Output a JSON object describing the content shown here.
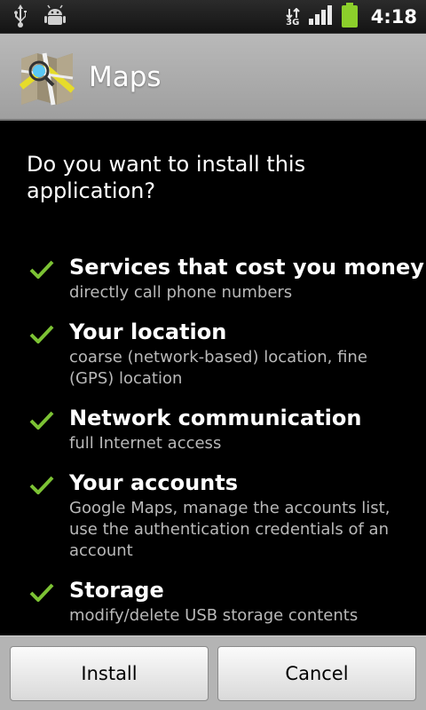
{
  "status_bar": {
    "icons_left": [
      "usb-icon",
      "android-debug-icon"
    ],
    "icons_right": [
      "3g-icon",
      "signal-icon",
      "battery-icon"
    ],
    "network": "3G",
    "time": "4:18",
    "battery_color": "#8ccf2b"
  },
  "header": {
    "app_icon": "maps-icon",
    "app_name": "Maps"
  },
  "prompt": "Do you want to install this application?",
  "permissions": [
    {
      "title": "Services that cost you money",
      "description": "directly call phone numbers"
    },
    {
      "title": "Your location",
      "description": "coarse (network-based) location, fine (GPS) location"
    },
    {
      "title": "Network communication",
      "description": "full Internet access"
    },
    {
      "title": "Your accounts",
      "description": "Google Maps, manage the accounts list, use the authentication credentials of an account"
    },
    {
      "title": "Storage",
      "description": "modify/delete USB storage contents"
    }
  ],
  "buttons": {
    "install": "Install",
    "cancel": "Cancel"
  },
  "colors": {
    "check": "#7cc234",
    "description_text": "#b9b9b9"
  }
}
